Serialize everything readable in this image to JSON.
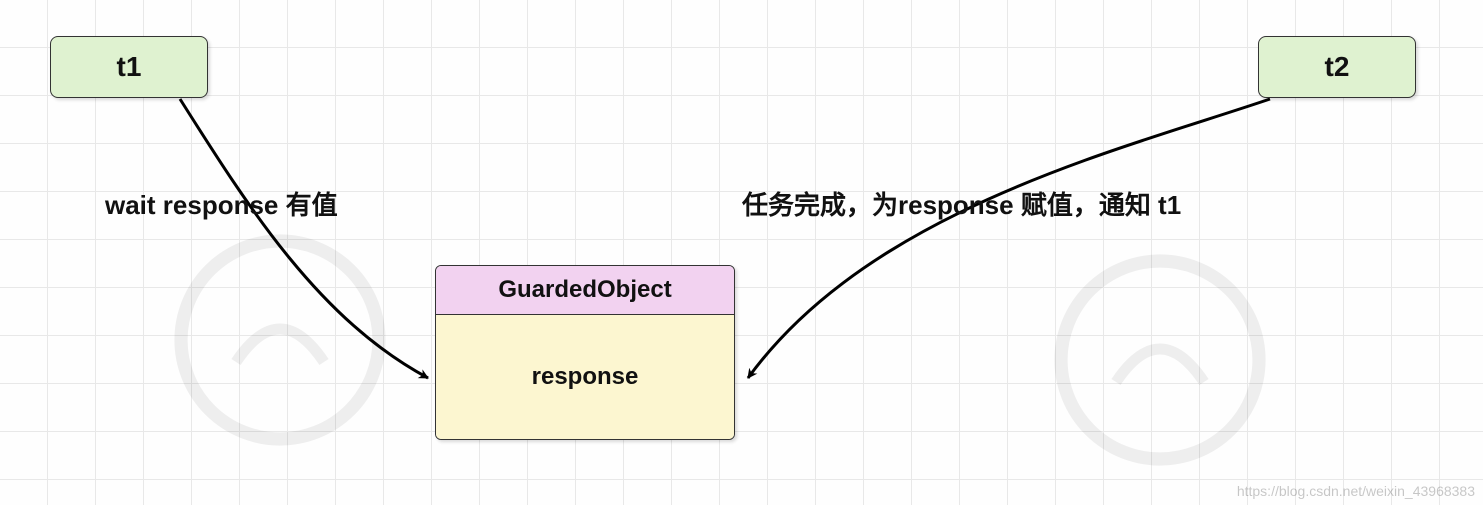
{
  "nodes": {
    "t1": {
      "label": "t1"
    },
    "t2": {
      "label": "t2"
    },
    "guarded": {
      "title": "GuardedObject",
      "body": "response"
    }
  },
  "edges": {
    "left": {
      "label": "wait response 有值"
    },
    "right": {
      "label": "任务完成，为response 赋值，通知 t1"
    }
  },
  "watermark": {
    "url": "https://blog.csdn.net/weixin_43968383"
  }
}
